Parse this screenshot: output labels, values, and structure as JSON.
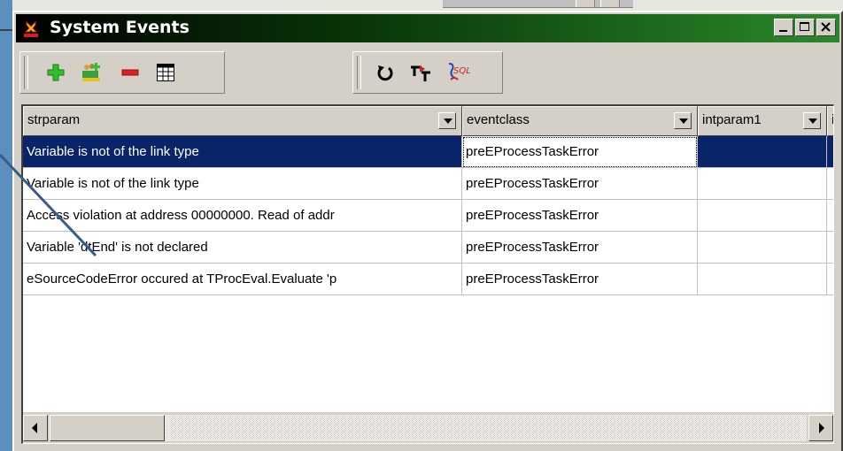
{
  "window": {
    "title": "System Events"
  },
  "grid": {
    "columns": [
      {
        "label": "strparam"
      },
      {
        "label": "eventclass"
      },
      {
        "label": "intparam1"
      },
      {
        "label": "i"
      }
    ],
    "rows": [
      {
        "strparam": "Variable is not of the link type",
        "eventclass": "preEProcessTaskError",
        "intparam1": ""
      },
      {
        "strparam": "Variable is not of the link type",
        "eventclass": "preEProcessTaskError",
        "intparam1": ""
      },
      {
        "strparam": "Access violation at address 00000000. Read of addr",
        "eventclass": "preEProcessTaskError",
        "intparam1": ""
      },
      {
        "strparam": "Variable 'dtEnd' is not declared",
        "eventclass": "preEProcessTaskError",
        "intparam1": ""
      },
      {
        "strparam": "eSourceCodeError occured at TProcEval.Evaluate 'p",
        "eventclass": "preEProcessTaskError",
        "intparam1": ""
      }
    ]
  },
  "colors": {
    "selection": "#0a246a",
    "title_gradient_end": "#2a8a2a",
    "annotation_arrow": "#3a5a8a"
  },
  "icons": {
    "window": "app-icon",
    "toolbar_group1": [
      "add-icon",
      "add-user-group-icon",
      "remove-icon",
      "grid-table-icon"
    ],
    "toolbar_group2": [
      "refresh-icon",
      "stepper-icon",
      "sql-icon"
    ]
  }
}
